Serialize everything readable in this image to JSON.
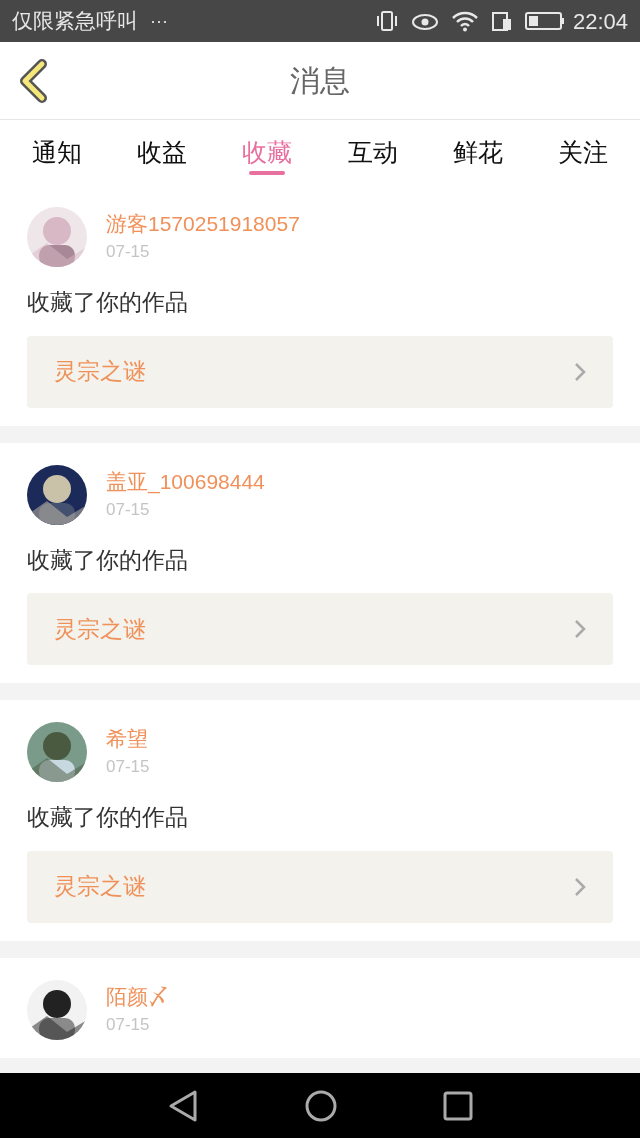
{
  "status_bar": {
    "notice": "仅限紧急呼叫",
    "more": "···",
    "time": "22:04"
  },
  "header": {
    "title": "消息"
  },
  "tabs": [
    {
      "label": "通知",
      "selected": false
    },
    {
      "label": "收益",
      "selected": false
    },
    {
      "label": "收藏",
      "selected": true
    },
    {
      "label": "互动",
      "selected": false
    },
    {
      "label": "鲜花",
      "selected": false
    },
    {
      "label": "关注",
      "selected": false
    }
  ],
  "messages": [
    {
      "user": "游客1570251918057",
      "date": "07-15",
      "text": "收藏了你的作品",
      "work": "灵宗之谜"
    },
    {
      "user": "盖亚_100698444",
      "date": "07-15",
      "text": "收藏了你的作品",
      "work": "灵宗之谜"
    },
    {
      "user": "希望",
      "date": "07-15",
      "text": "收藏了你的作品",
      "work": "灵宗之谜"
    },
    {
      "user": "陌颜〆",
      "date": "07-15"
    }
  ]
}
